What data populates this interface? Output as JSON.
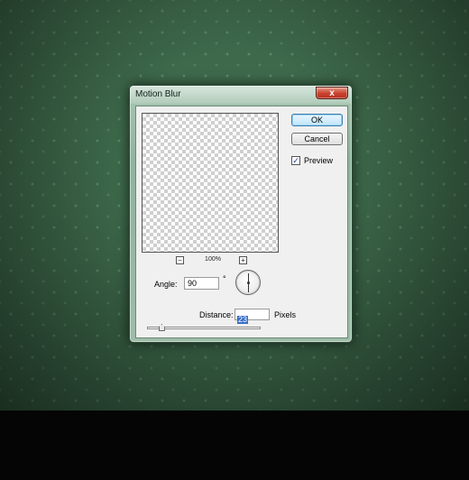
{
  "dialog": {
    "title": "Motion Blur",
    "close_label": "x"
  },
  "buttons": {
    "ok_label": "OK",
    "cancel_label": "Cancel"
  },
  "preview": {
    "label": "Preview",
    "checked": true,
    "check_mark": "✓",
    "zoom_out": "−",
    "zoom_in": "+",
    "zoom_level": "100%"
  },
  "angle": {
    "label": "Angle:",
    "value": "90",
    "unit": "°"
  },
  "distance": {
    "label": "Distance:",
    "value": "23",
    "unit": "Pixels",
    "slider_fraction": 0.13
  }
}
